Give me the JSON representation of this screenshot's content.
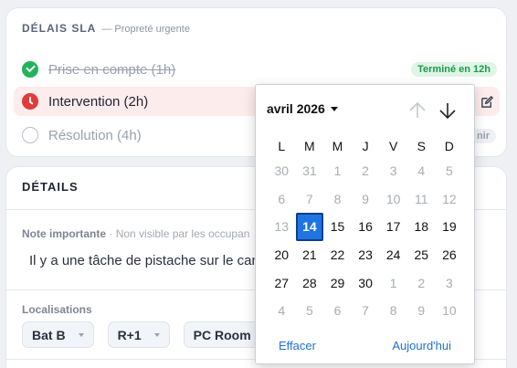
{
  "sla": {
    "title": "DÉLAIS SLA",
    "subtitle": "— Propreté urgente",
    "rows": [
      {
        "label": "Prise en compte (1h)",
        "status": "done",
        "badge": "Terminé en 12h"
      },
      {
        "label": "Intervention (2h)",
        "status": "late"
      },
      {
        "label": "Résolution (4h)",
        "status": "todo",
        "badge": "nir"
      }
    ]
  },
  "details": {
    "title": "DÉTAILS",
    "note_label": "Note importante",
    "note_separator": "·",
    "note_hint": "Non visible par les occupan",
    "note_text": "Il y a une tâche de pistache sur le canap",
    "locations_label": "Localisations",
    "locations": [
      "Bat B",
      "R+1",
      "PC Room"
    ]
  },
  "datepicker": {
    "month_label": "avril 2026",
    "weekdays": [
      "L",
      "M",
      "M",
      "J",
      "V",
      "S",
      "D"
    ],
    "days": [
      {
        "d": "30",
        "m": 1
      },
      {
        "d": "31",
        "m": 1
      },
      {
        "d": "1",
        "m": 1
      },
      {
        "d": "2",
        "m": 1
      },
      {
        "d": "3",
        "m": 1
      },
      {
        "d": "4",
        "m": 1
      },
      {
        "d": "5",
        "m": 1
      },
      {
        "d": "6",
        "m": 1
      },
      {
        "d": "7",
        "m": 1
      },
      {
        "d": "8",
        "m": 1
      },
      {
        "d": "9",
        "m": 1
      },
      {
        "d": "10",
        "m": 1
      },
      {
        "d": "11",
        "m": 1
      },
      {
        "d": "12",
        "m": 1
      },
      {
        "d": "13",
        "m": 1
      },
      {
        "d": "14",
        "m": 0,
        "sel": 1
      },
      {
        "d": "15",
        "m": 0
      },
      {
        "d": "16",
        "m": 0
      },
      {
        "d": "17",
        "m": 0
      },
      {
        "d": "18",
        "m": 0
      },
      {
        "d": "19",
        "m": 0
      },
      {
        "d": "20",
        "m": 0
      },
      {
        "d": "21",
        "m": 0
      },
      {
        "d": "22",
        "m": 0
      },
      {
        "d": "23",
        "m": 0
      },
      {
        "d": "24",
        "m": 0
      },
      {
        "d": "25",
        "m": 0
      },
      {
        "d": "26",
        "m": 0
      },
      {
        "d": "27",
        "m": 0
      },
      {
        "d": "28",
        "m": 0
      },
      {
        "d": "29",
        "m": 0
      },
      {
        "d": "30",
        "m": 0
      },
      {
        "d": "1",
        "m": 1
      },
      {
        "d": "2",
        "m": 1
      },
      {
        "d": "3",
        "m": 1
      },
      {
        "d": "4",
        "m": 1
      },
      {
        "d": "5",
        "m": 1
      },
      {
        "d": "6",
        "m": 1
      },
      {
        "d": "7",
        "m": 1
      },
      {
        "d": "8",
        "m": 1
      },
      {
        "d": "9",
        "m": 1
      },
      {
        "d": "10",
        "m": 1
      }
    ],
    "clear_label": "Effacer",
    "today_label": "Aujourd'hui"
  },
  "colors": {
    "accent": "#1f74e0",
    "success": "#22b35a",
    "danger": "#e03b3b"
  },
  "icons": {
    "row1": "check-circle-icon",
    "row2": "clock-alert-icon",
    "row3": "empty-circle-icon",
    "edit": "edit-icon",
    "prev": "arrow-up-icon",
    "next": "arrow-down-icon"
  }
}
